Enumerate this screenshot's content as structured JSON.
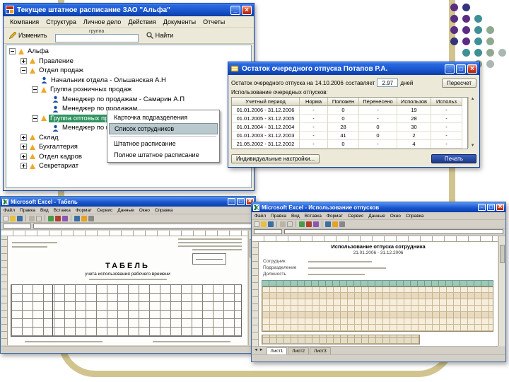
{
  "decor": {
    "frame_color": "#d2c48e",
    "dot_palette": {
      "purple": "#5a2d82",
      "indigo": "#34347e",
      "teal": "#3e8f96",
      "sage": "#8fa98f",
      "gray": "#aab7b2"
    },
    "dot_grid": [
      [
        "purple",
        "indigo",
        "",
        "",
        ""
      ],
      [
        "purple",
        "purple",
        "teal",
        "",
        ""
      ],
      [
        "purple",
        "purple",
        "teal",
        "sage",
        ""
      ],
      [
        "indigo",
        "purple",
        "teal",
        "sage",
        ""
      ],
      [
        "",
        "teal",
        "teal",
        "sage",
        "gray"
      ],
      [
        "",
        "",
        "sage",
        "gray",
        ""
      ]
    ]
  },
  "staff_window": {
    "title": "Текущее штатное расписание  ЗАО \"Альфа\"",
    "menu": [
      "Компания",
      "Структура",
      "Личное дело",
      "Действия",
      "Документы",
      "Отчеты"
    ],
    "toolbar": {
      "edit": "Изменить",
      "group_label": "группа",
      "find": "Найти"
    },
    "icons": {
      "org_unit": "triangle",
      "employee": "person",
      "expanded": "minus",
      "collapsed": "plus"
    },
    "tree": [
      {
        "label": "Альфа"
      },
      {
        "label": "Правление"
      },
      {
        "label": "Отдел продаж"
      },
      {
        "label": "Начальник отдела - Ольшанская А.Н"
      },
      {
        "label": "Группа розничных продаж"
      },
      {
        "label": "Менеджер по продажам - Самарин А.П"
      },
      {
        "label": "Менеджер по продажам"
      },
      {
        "label": "Группа оптовых продаж"
      },
      {
        "label": "Менеджер по продажам"
      },
      {
        "label": "Склад"
      },
      {
        "label": "Бухгалтерия"
      },
      {
        "label": "Отдел кадров"
      },
      {
        "label": "Секретариат"
      }
    ],
    "context_menu": {
      "items": [
        "Карточка подразделения",
        "Список сотрудников",
        "Штатное расписание",
        "Полное штатное расписание"
      ],
      "highlighted": "Список сотрудников"
    }
  },
  "vacation_window": {
    "title": "Остаток очередного отпуска  Потапов Р.А.",
    "balance_line": {
      "prefix": "Остаток очередного отпуска на",
      "date": "14.10.2006",
      "mid": "составляет",
      "value": "2.97",
      "units": "дней",
      "recalc_button": "Пересчет"
    },
    "usage_label": "Использование очередных отпусков:",
    "table": {
      "headers": [
        "Учетный период",
        "Норма",
        "Положен",
        "Перенесено",
        "Использов",
        "Использ"
      ],
      "rows": [
        [
          "01.01.2006 - 31.12.2006",
          "-",
          "0",
          "-",
          "19",
          "-"
        ],
        [
          "01.01.2005 - 31.12.2005",
          "-",
          "0",
          "-",
          "28",
          "-"
        ],
        [
          "01.01.2004 - 31.12.2004",
          "-",
          "28",
          "0",
          "30",
          "-"
        ],
        [
          "01.01.2003 - 31.12.2003",
          "-",
          "41",
          "0",
          "2",
          "-"
        ],
        [
          "21.05.2002 - 31.12.2002",
          "-",
          "0",
          "-",
          "4",
          "-"
        ]
      ]
    },
    "buttons": {
      "individual": "Индивидуальные настройки...",
      "print": "Печать"
    }
  },
  "excel_left": {
    "title": "Microsoft Excel - Табель",
    "menu": [
      "Файл",
      "Правка",
      "Вид",
      "Вставка",
      "Формат",
      "Сервис",
      "Данные",
      "Окно",
      "Справка"
    ],
    "form": {
      "title": "ТАБЕЛЬ",
      "subtitle": "учета использования рабочего времени"
    }
  },
  "excel_right": {
    "title": "Microsoft Excel - Использование отпусков",
    "menu": [
      "Файл",
      "Правка",
      "Вид",
      "Вставка",
      "Формат",
      "Сервис",
      "Данные",
      "Окно",
      "Справка"
    ],
    "doc": {
      "title": "Использование отпуска сотрудника",
      "period": "21.01.2006 - 31.12.2006",
      "labels": [
        "Сотрудник",
        "Подразделение",
        "Должность"
      ]
    },
    "sheet_tabs": [
      "Лист1",
      "Лист2",
      "Лист3"
    ]
  }
}
